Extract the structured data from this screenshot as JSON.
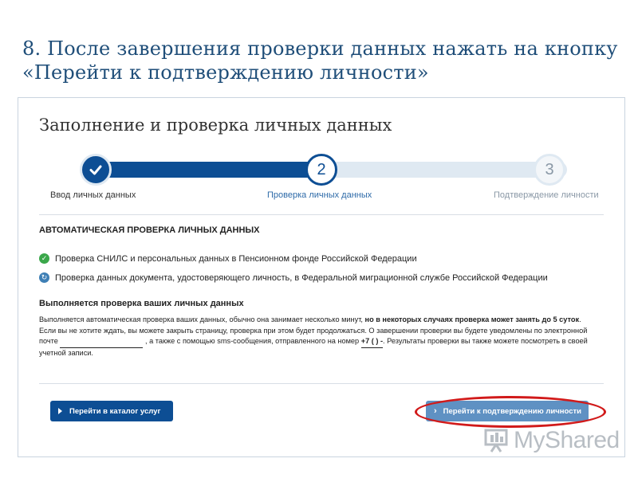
{
  "slide": {
    "title": "8. После завершения проверки данных нажать на кнопку «Перейти к подтверждению личности»"
  },
  "form": {
    "title": "Заполнение и проверка личных данных",
    "steps": [
      {
        "number": "",
        "label": "Ввод личных данных",
        "state": "done",
        "icon": "checkmark-icon"
      },
      {
        "number": "2",
        "label": "Проверка личных данных",
        "state": "current"
      },
      {
        "number": "3",
        "label": "Подтверждение личности",
        "state": "pending"
      }
    ],
    "section_heading": "АВТОМАТИЧЕСКАЯ ПРОВЕРКА ЛИЧНЫХ ДАННЫХ",
    "checks": [
      {
        "text": "Проверка СНИЛС и персональных данных в Пенсионном фонде Российской Федерации",
        "status": "done",
        "icon": "check-circle-icon"
      },
      {
        "text": "Проверка данных документа, удостоверяющего личность, в Федеральной миграционной службе Российской Федерации",
        "status": "in-progress",
        "icon": "spinner-icon"
      }
    ],
    "progress_heading": "Выполняется проверка ваших личных данных",
    "info": {
      "p1": "Выполняется автоматическая проверка ваших данных, обычно она занимает несколько минут, ",
      "p1_bold": "но в некоторых случаях проверка может занять до 5 суток",
      "p2": ". Если вы не хотите ждать, вы можете закрыть страницу, проверка при этом будет продолжаться. О завершении проверки вы будете уведомлены по электронной почте ",
      "p3": " , а также с помощью sms-сообщения, отправленного на номер ",
      "phone": "+7 (     )       -",
      "p4": ". Результаты проверки вы также можете посмотреть в своей учетной записи."
    },
    "buttons": {
      "catalog": "Перейти в каталог услуг",
      "confirm": "Перейти к подтверждению личности"
    }
  },
  "watermark": {
    "text": "MyShared"
  },
  "colors": {
    "primary": "#0d4e94",
    "success": "#3aa74a",
    "highlight": "#d11a1a",
    "title": "#1f4e79"
  }
}
